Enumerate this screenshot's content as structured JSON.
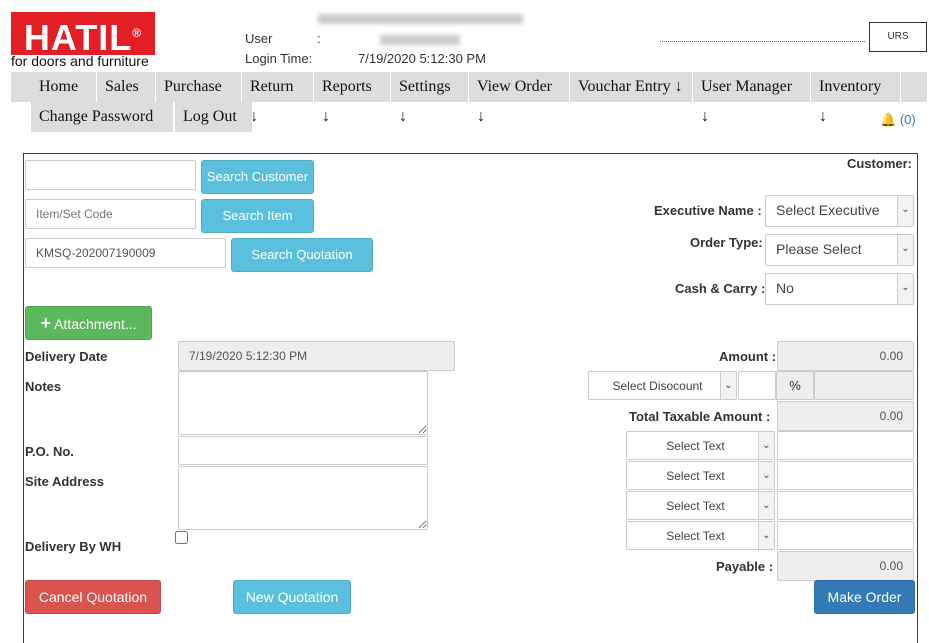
{
  "brand": {
    "logo": "HATIL",
    "tagline": "for doors and furniture"
  },
  "header": {
    "user_label": "User",
    "user_sep": ":",
    "login_label": "Login Time:",
    "login_time": "7/19/2020 5:12:30 PM"
  },
  "nav": [
    "Home",
    "Sales ↓",
    "Purchase ↓",
    "Return ↓",
    "Reports ↓",
    "Settings ↓",
    "View Order ↓",
    "Vouchar Entry ↓",
    "User Manager ↓",
    "Inventory ↓",
    "Change Password",
    "Log Out"
  ],
  "notifications": {
    "count": "(0)"
  },
  "form": {
    "customer_input": "",
    "search_customer": "Search Customer",
    "item_placeholder": "Item/Set Code",
    "search_item": "Search Item",
    "quotation_no": "KMSQ-202007190009",
    "search_quotation": "Search Quotation",
    "attachment": "Attachment...",
    "customer_label": "Customer:",
    "executive_label": "Executive Name :",
    "executive_value": "Select Executive",
    "order_type_label": "Order Type:",
    "order_type_value": "Please Select",
    "cash_carry_label": "Cash & Carry :",
    "cash_carry_value": "No",
    "delivery_date_label": "Delivery Date",
    "delivery_date": "7/19/2020 5:12:30 PM",
    "notes_label": "Notes",
    "po_label": "P.O. No.",
    "site_label": "Site Address",
    "wh_label": "Delivery By WH",
    "amount_label": "Amount :",
    "amount": "0.00",
    "discount_select": "Select Disocount",
    "percent": "%",
    "taxable_label": "Total Taxable Amount :",
    "taxable": "0.00",
    "select_text": "Select Text",
    "payable_label": "Payable :",
    "payable": "0.00",
    "cancel": "Cancel Quotation",
    "new": "New Quotation",
    "make_order": "Make Order"
  }
}
